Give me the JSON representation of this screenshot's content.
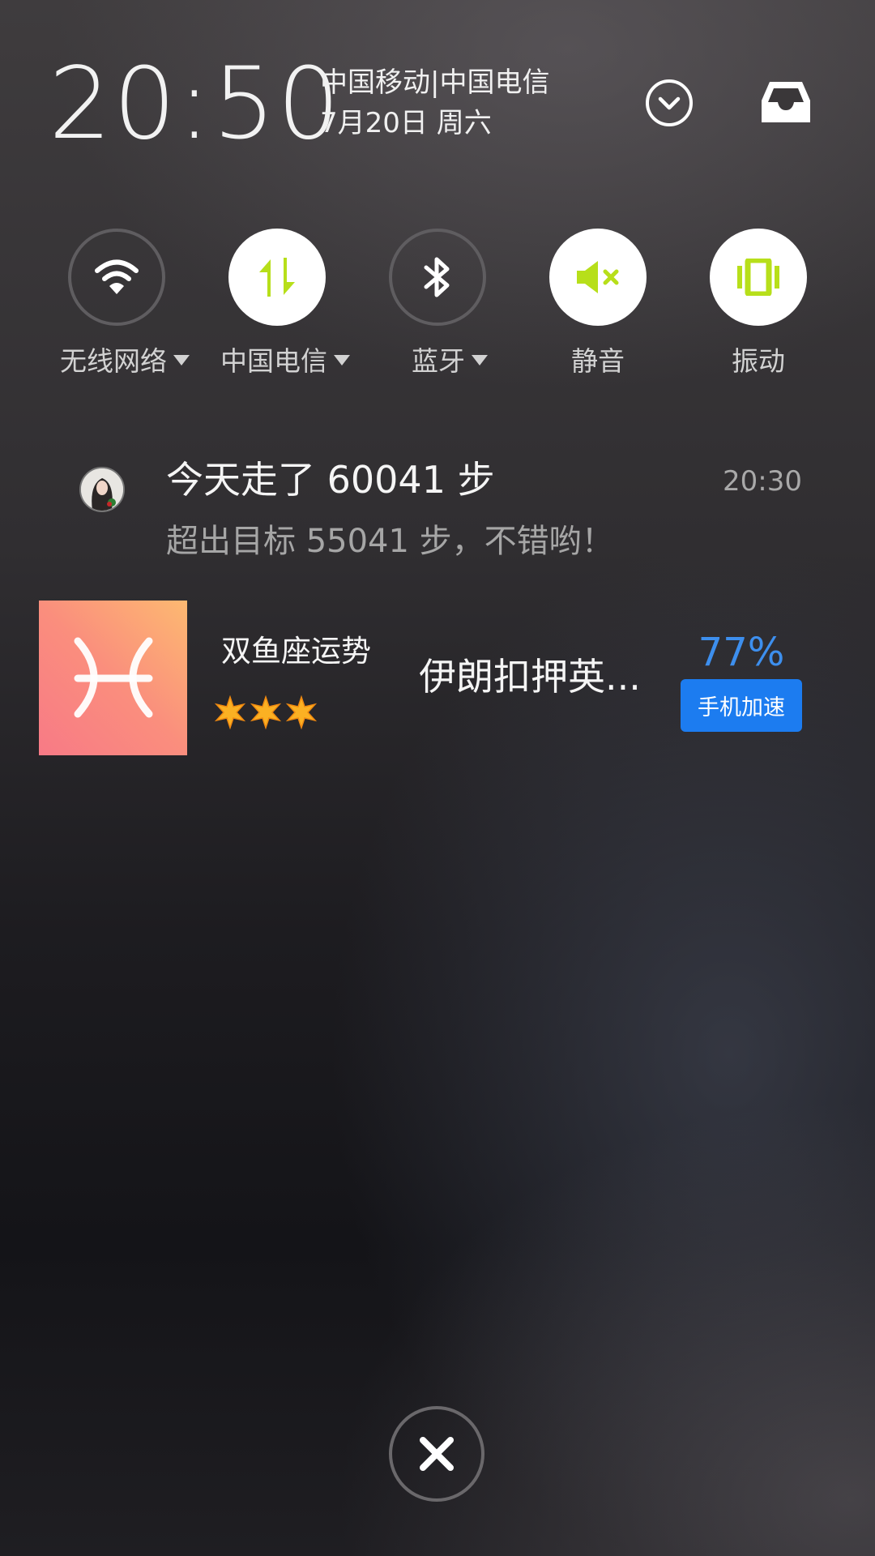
{
  "status": {
    "time": "20:50",
    "carrier": "中国移动|中国电信",
    "date": "7月20日 周六"
  },
  "header": {
    "expand_icon": "chevron-down-circle-icon",
    "inbox_icon": "inbox-icon"
  },
  "toggles": [
    {
      "label": "无线网络",
      "icon": "wifi-icon",
      "state": "off",
      "has_dropdown": true
    },
    {
      "label": "中国电信",
      "icon": "mobile-data-icon",
      "state": "on",
      "has_dropdown": true
    },
    {
      "label": "蓝牙",
      "icon": "bluetooth-icon",
      "state": "off",
      "has_dropdown": true
    },
    {
      "label": "静音",
      "icon": "mute-icon",
      "state": "on",
      "has_dropdown": false
    },
    {
      "label": "振动",
      "icon": "vibrate-icon",
      "state": "on",
      "has_dropdown": false
    }
  ],
  "notifications": [
    {
      "title": "今天走了 60041 步",
      "time": "20:30",
      "text": "超出目标 55041 步，不错哟！",
      "icon": "avatar"
    },
    {
      "title": "双鱼座运势",
      "stars": 3,
      "headline": "伊朗扣押英...",
      "percent": "77%",
      "button": "手机加速",
      "icon": "pisces-icon"
    }
  ],
  "close_icon": "close-icon",
  "colors": {
    "accent_green": "#b7df1a",
    "accent_blue": "#1c7cf0",
    "percent_blue": "#3d8fee"
  }
}
